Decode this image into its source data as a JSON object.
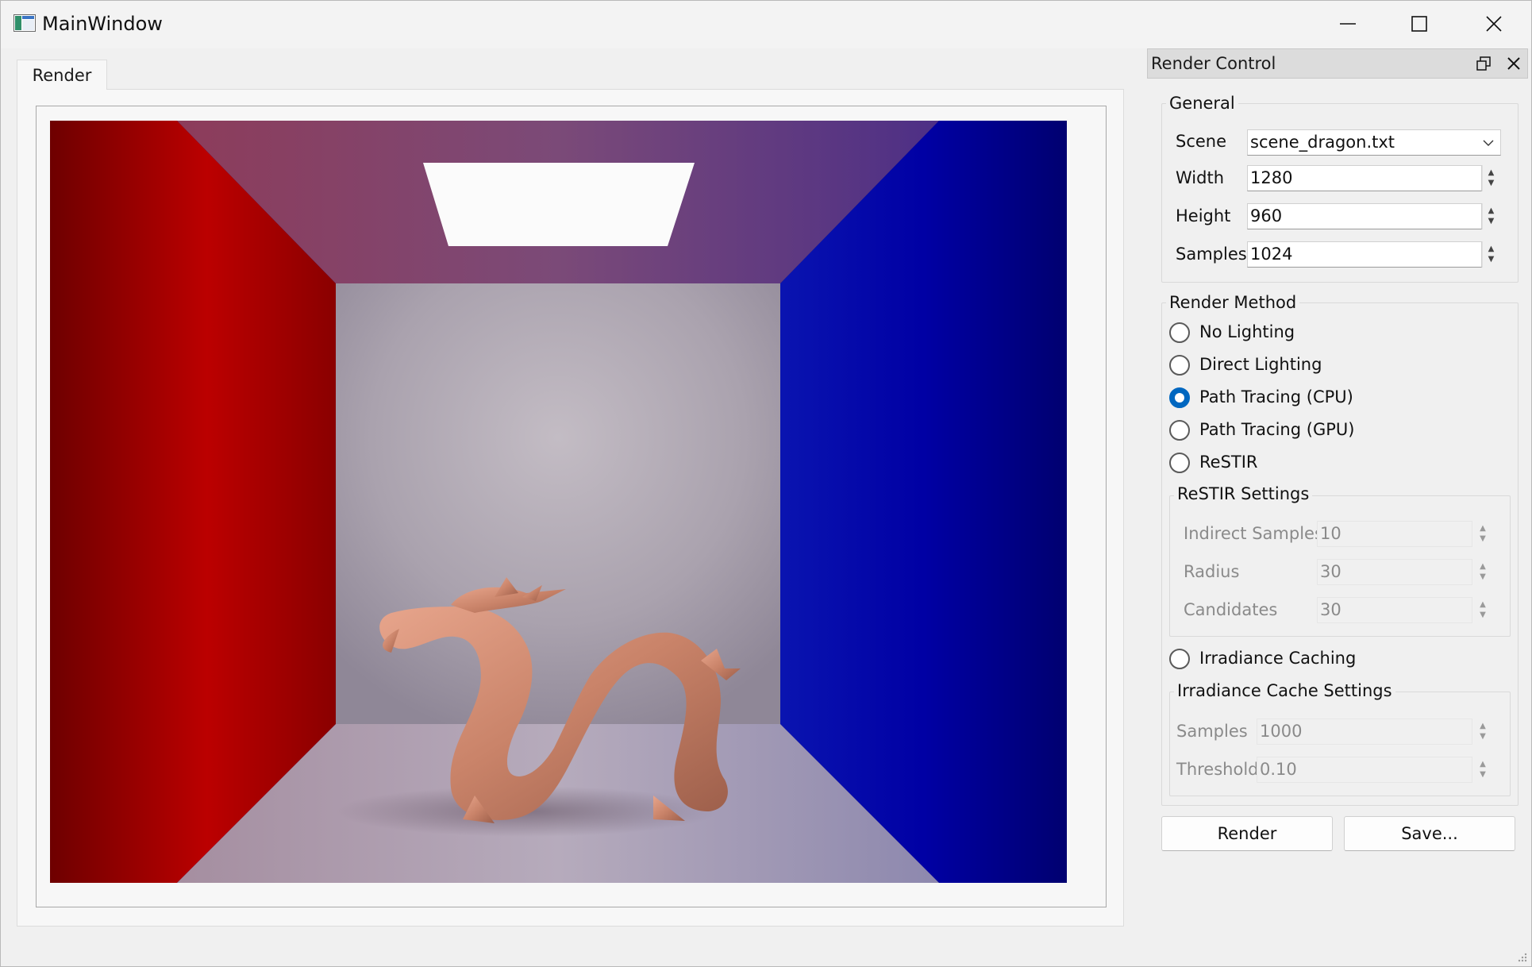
{
  "window": {
    "title": "MainWindow"
  },
  "tabs": [
    {
      "label": "Render"
    }
  ],
  "dock": {
    "title": "Render Control"
  },
  "general": {
    "title": "General",
    "scene_label": "Scene",
    "scene_value": "scene_dragon.txt",
    "width_label": "Width",
    "width_value": "1280",
    "height_label": "Height",
    "height_value": "960",
    "samples_label": "Samples",
    "samples_value": "1024"
  },
  "render_method": {
    "title": "Render Method",
    "options": [
      {
        "label": "No Lighting",
        "selected": false
      },
      {
        "label": "Direct Lighting",
        "selected": false
      },
      {
        "label": "Path Tracing (CPU)",
        "selected": true
      },
      {
        "label": "Path Tracing (GPU)",
        "selected": false
      },
      {
        "label": "ReSTIR",
        "selected": false
      }
    ],
    "irradiance_option": {
      "label": "Irradiance Caching",
      "selected": false
    }
  },
  "restir_settings": {
    "title": "ReSTIR Settings",
    "indirect_label": "Indirect Samples",
    "indirect_value": "10",
    "radius_label": "Radius",
    "radius_value": "30",
    "candidates_label": "Candidates",
    "candidates_value": "30"
  },
  "irradiance_settings": {
    "title": "Irradiance Cache Settings",
    "samples_label": "Samples",
    "samples_value": "1000",
    "threshold_label": "Threshold",
    "threshold_value": "0.10"
  },
  "actions": {
    "render_label": "Render",
    "save_label": "Save..."
  },
  "colors": {
    "accent": "#0067c0",
    "left_wall": "#b80000",
    "right_wall": "#0000a8"
  }
}
